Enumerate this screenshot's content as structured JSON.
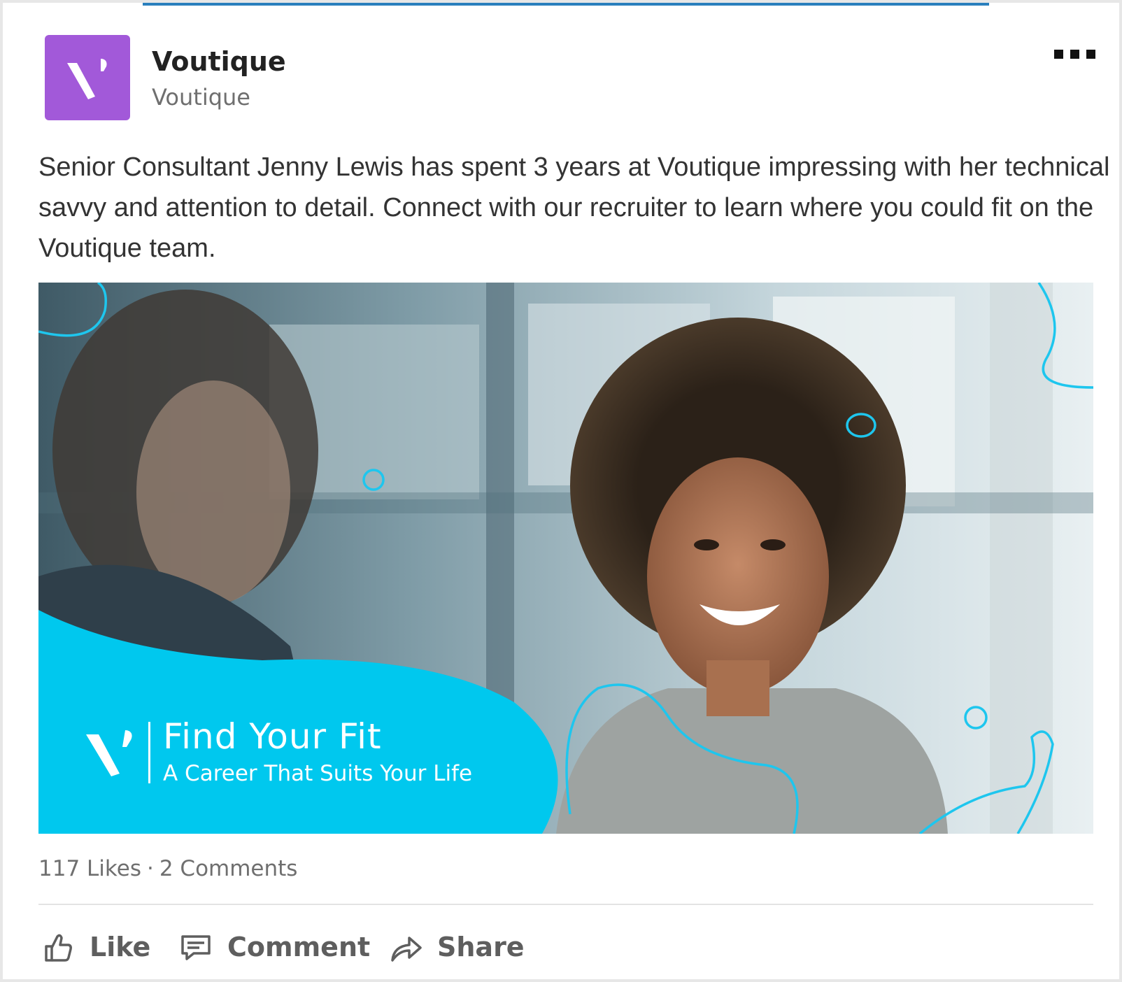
{
  "post": {
    "author_name": "Voutique",
    "author_subtitle": "Voutique",
    "logo_color": "#a259d9",
    "more_icon": "more-horizontal-icon",
    "text": "Senior Consultant Jenny Lewis has spent 3 years at Voutique impressing with her technical savvy and attention to detail. Connect with our recruiter to learn where you could fit on the Voutique team."
  },
  "image": {
    "headline": "Find Your Fit",
    "tagline": "A Career That Suits Your Life",
    "accent_color": "#00c8ee"
  },
  "stats": {
    "likes": "117 Likes",
    "separator": "·",
    "comments": "2 Comments"
  },
  "actions": {
    "like": {
      "label": "Like",
      "icon": "thumbs-up-icon"
    },
    "comment": {
      "label": "Comment",
      "icon": "comment-icon"
    },
    "share": {
      "label": "Share",
      "icon": "share-arrow-icon"
    }
  },
  "colors": {
    "text": "#333333",
    "muted": "#6f6f6f",
    "action": "#5e5e5e",
    "top_accent": "#2a7fbd"
  }
}
